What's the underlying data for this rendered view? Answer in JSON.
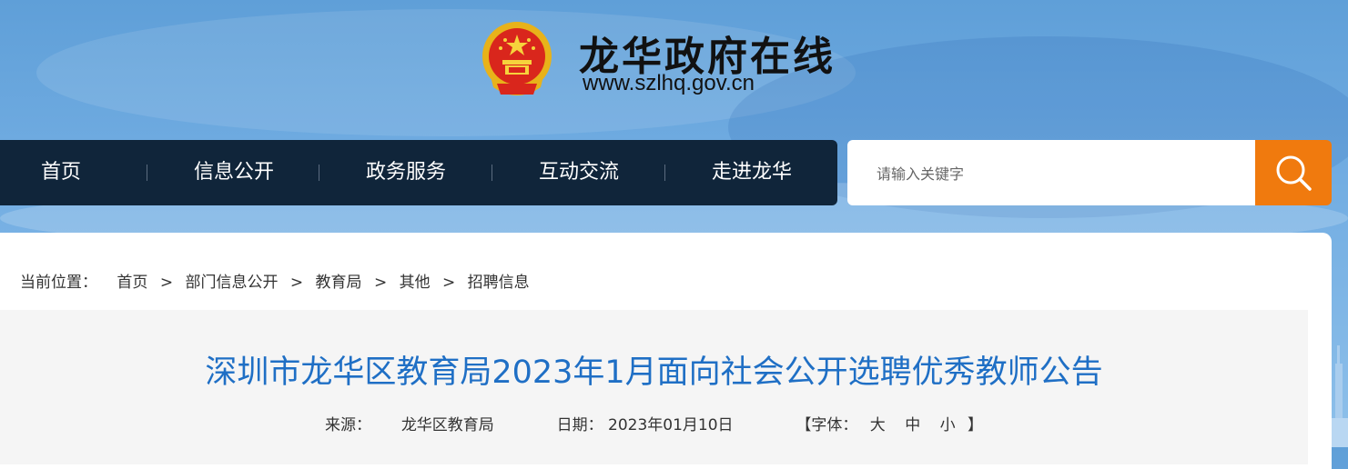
{
  "header": {
    "site_title": "龙华政府在线",
    "site_url": "www.szlhq.gov.cn",
    "emblem_icon": "national-emblem-icon"
  },
  "nav": {
    "items": [
      {
        "label": "首页"
      },
      {
        "label": "信息公开"
      },
      {
        "label": "政务服务"
      },
      {
        "label": "互动交流"
      },
      {
        "label": "走进龙华"
      }
    ]
  },
  "search": {
    "placeholder": "请输入关键字",
    "value": "",
    "button_icon": "search-icon"
  },
  "breadcrumb": {
    "label": "当前位置：",
    "items": [
      "首页",
      "部门信息公开",
      "教育局",
      "其他",
      "招聘信息"
    ],
    "separator": ">"
  },
  "article": {
    "title": "深圳市龙华区教育局2023年1月面向社会公开选聘优秀教师公告",
    "source_label": "来源：",
    "source": "龙华区教育局",
    "date_label": "日期：",
    "date": "2023年01月10日",
    "font_label": "【字体：",
    "font_sizes": [
      "大",
      "中",
      "小"
    ],
    "font_close": "】"
  },
  "colors": {
    "nav_bg": "#10253a",
    "search_button": "#f07a0e",
    "title_blue": "#1f6fc5",
    "page_bg": "#6aa8e0"
  }
}
